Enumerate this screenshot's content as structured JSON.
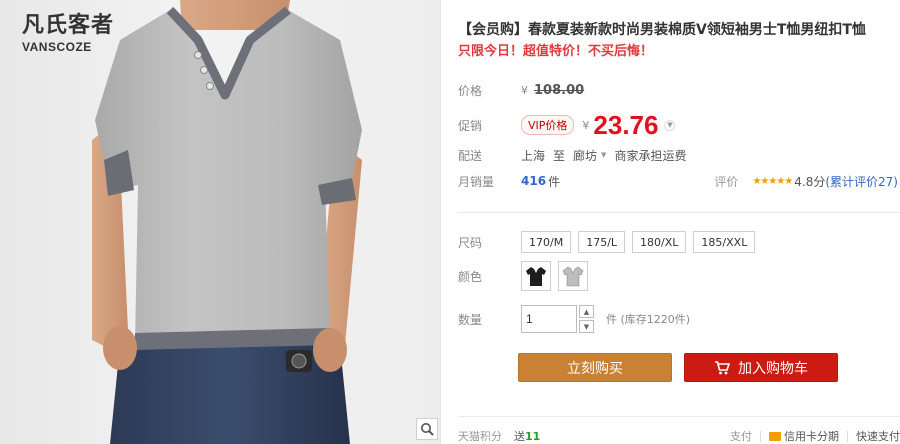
{
  "brand": {
    "cn": "凡氏客者",
    "en": "VANSCOZE"
  },
  "product": {
    "title": "【会员购】春款夏装新款时尚男装棉质V领短袖男士T恤男纽扣T恤",
    "promo": "只限今日！超值特价！不买后悔！"
  },
  "price": {
    "label": "价格",
    "currency": "¥",
    "original": "108.00"
  },
  "promotion": {
    "label": "促销",
    "vip_tag": "VIP价格",
    "currency": "¥",
    "value": "23.76"
  },
  "delivery": {
    "label": "配送",
    "from": "上海",
    "to_word": "至",
    "to": "廊坊",
    "fee": "商家承担运费"
  },
  "sales": {
    "label": "月销量",
    "count": "416",
    "unit": "件",
    "rating_label": "评价",
    "stars": "★★★★★",
    "score": "4.8分",
    "reviews": "(累计评价27)"
  },
  "sizes": {
    "label": "尺码",
    "options": [
      "170/M",
      "175/L",
      "180/XL",
      "185/XXL"
    ]
  },
  "colors": {
    "label": "颜色",
    "options": [
      {
        "name": "black",
        "hex": "#1e1e1e"
      },
      {
        "name": "grey",
        "hex": "#bdbdbd"
      }
    ]
  },
  "quantity": {
    "label": "数量",
    "value": "1",
    "unit": "件",
    "stock": "(库存1220件)"
  },
  "actions": {
    "buy": "立刻购买",
    "cart": "加入购物车"
  },
  "footer": {
    "points_label": "天猫积分",
    "points_prefix": "送",
    "points": "11",
    "pay_label": "支付",
    "card": "信用卡分期",
    "quick": "快速支付"
  },
  "colors_theme": {
    "price_red": "#e4101d",
    "buy_orange": "#c98133",
    "cart_red": "#cc1b12",
    "link_blue": "#3366cc",
    "star_orange": "#ff9900"
  }
}
